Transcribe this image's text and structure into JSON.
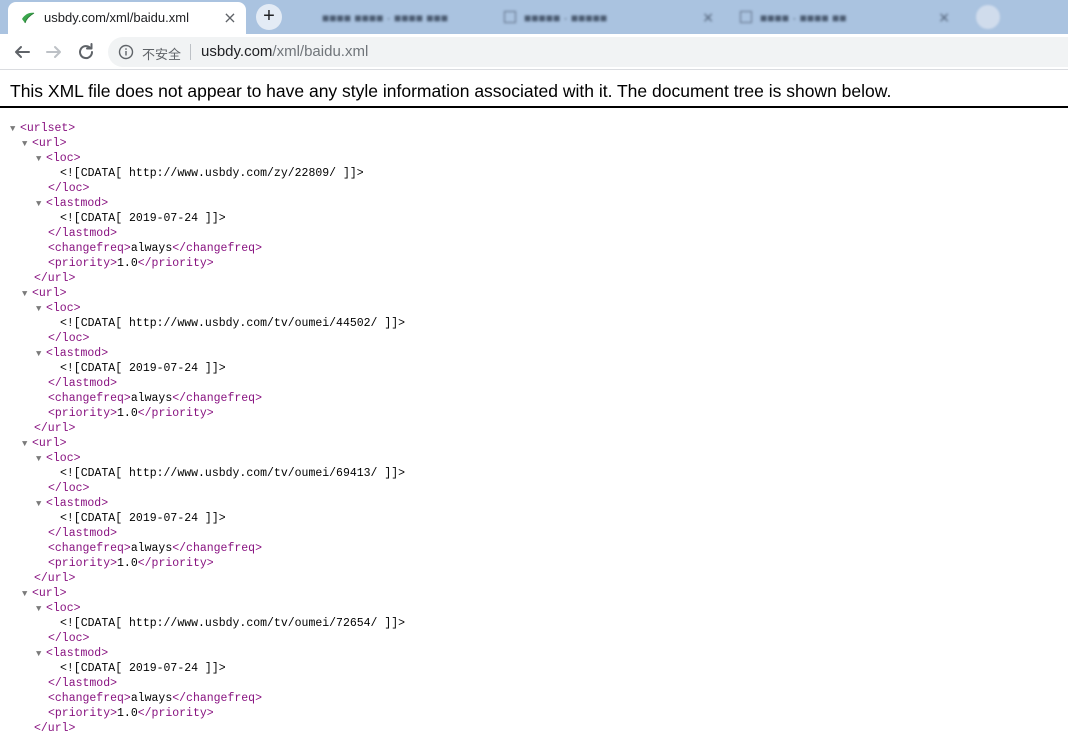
{
  "browser": {
    "active_tab": {
      "title": "usbdy.com/xml/baidu.xml",
      "close": "×"
    },
    "new_tab_symbol": "+",
    "background_tabs": [
      {
        "title": "■■■■ ■■■■ · ■■■■ ■■■"
      },
      {
        "title": "■■■■■ · ■■■■■"
      },
      {
        "title": "■■■■ · ■■■■ ■■"
      }
    ],
    "security_label": "不安全",
    "url": {
      "host": "usbdy.com",
      "path": "/xml/baidu.xml"
    },
    "icons": [
      "favicon-icon",
      "close-icon",
      "plus-icon",
      "back-arrow-icon",
      "forward-arrow-icon",
      "reload-icon",
      "info-icon"
    ]
  },
  "xml_viewer": {
    "header": "This XML file does not appear to have any style information associated with it. The document tree is shown below.",
    "root_open": "<urlset>",
    "url_open": "<url>",
    "url_close": "</url>",
    "loc_open": "<loc>",
    "loc_close": "</loc>",
    "lastmod_open": "<lastmod>",
    "lastmod_close": "</lastmod>",
    "changefreq_open": "<changefreq>",
    "changefreq_close": "</changefreq>",
    "priority_open": "<priority>",
    "priority_close": "</priority>",
    "entries": [
      {
        "loc": "<![CDATA[ http://www.usbdy.com/zy/22809/ ]]>",
        "lastmod": "<![CDATA[ 2019-07-24 ]]>",
        "changefreq": "always",
        "priority": "1.0"
      },
      {
        "loc": "<![CDATA[ http://www.usbdy.com/tv/oumei/44502/ ]]>",
        "lastmod": "<![CDATA[ 2019-07-24 ]]>",
        "changefreq": "always",
        "priority": "1.0"
      },
      {
        "loc": "<![CDATA[ http://www.usbdy.com/tv/oumei/69413/ ]]>",
        "lastmod": "<![CDATA[ 2019-07-24 ]]>",
        "changefreq": "always",
        "priority": "1.0"
      },
      {
        "loc": "<![CDATA[ http://www.usbdy.com/tv/oumei/72654/ ]]>",
        "lastmod": "<![CDATA[ 2019-07-24 ]]>",
        "changefreq": "always",
        "priority": "1.0"
      }
    ]
  }
}
